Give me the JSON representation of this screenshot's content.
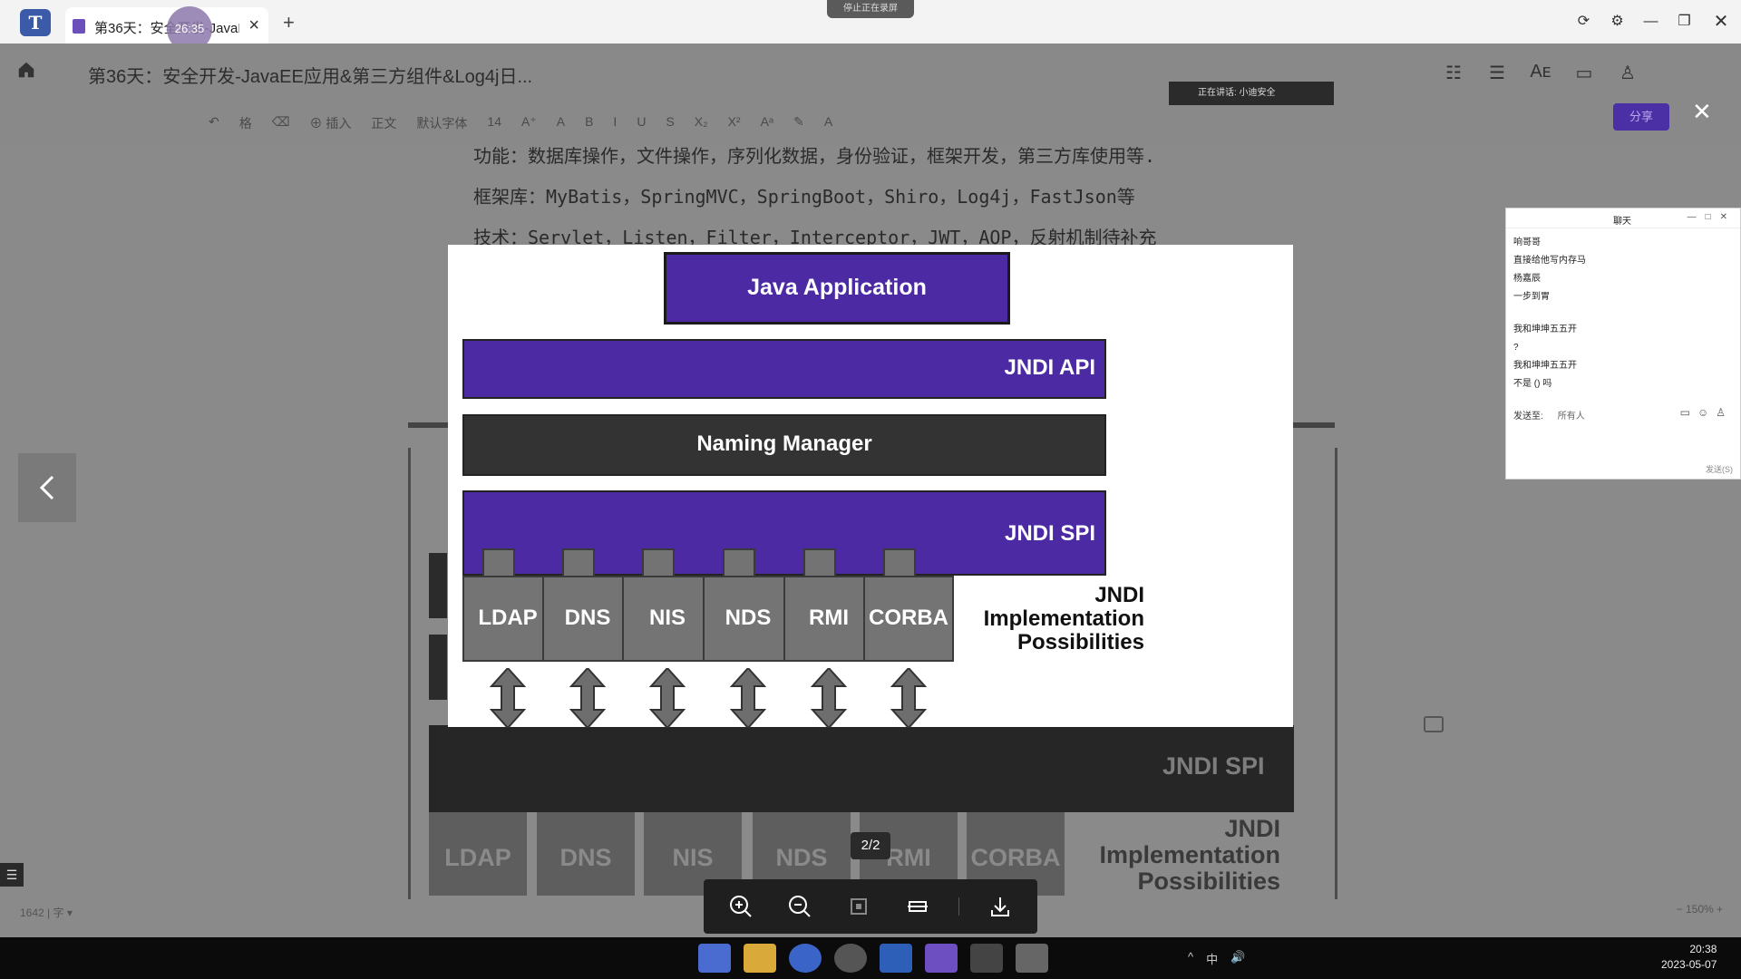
{
  "window": {
    "tab_title": "第36天：安全开发-JavaEE应用...",
    "timer": "26:35",
    "notice": "停止正在录屏",
    "ctrl_icons": [
      "refresh-icon",
      "settings-icon",
      "minimize-icon",
      "restore-icon",
      "close-icon"
    ]
  },
  "header": {
    "doc_title": "第36天：安全开发-JavaEE应用&第三方组件&Log4j日...",
    "mic_text": "正在讲话: 小迪安全",
    "share_label": "分享"
  },
  "toolbar": {
    "items": [
      "↶",
      "格",
      "⌫",
      "⊕ 插入",
      "正文",
      "默认字体",
      "14",
      "A⁺",
      "A",
      "B",
      "I",
      "U",
      "S",
      "X₂",
      "X²",
      "Aᵃ",
      "✎",
      "A"
    ]
  },
  "document": {
    "line1": "功能：数据库操作，文件操作，序列化数据，身份验证，框架开发，第三方库使用等.",
    "line2": "框架库：MyBatis，SpringMVC，SpringBoot，Shiro，Log4j，FastJson等",
    "line3": "技术：Servlet，Listen，Filter，Interceptor，JWT，AOP，反射机制待补充"
  },
  "diagram": {
    "app": "Java Application",
    "api": "JNDI API",
    "manager": "Naming Manager",
    "spi": "JNDI SPI",
    "providers": [
      "LDAP",
      "DNS",
      "NIS",
      "NDS",
      "RMI",
      "CORBA"
    ],
    "impl_label": [
      "JNDI",
      "Implementation",
      "Possibilities"
    ],
    "colors": {
      "layer": "#4b2aa3",
      "manager": "#333333",
      "provider": "#747474"
    }
  },
  "background_slide": {
    "spi": "JNDI SPI",
    "providers": [
      "LDAP",
      "DNS",
      "NIS",
      "NDS",
      "RMI",
      "CORBA"
    ],
    "impl_label": [
      "JNDI",
      "Implementation",
      "Possibilities"
    ]
  },
  "viewer": {
    "page": "2/2",
    "tools": [
      "zoom-in-icon",
      "zoom-out-icon",
      "fit-icon",
      "rotate-icon",
      "download-icon"
    ]
  },
  "chat": {
    "title": "聊天",
    "messages": [
      "响哥哥",
      "直接给他写内存马",
      "杨嘉辰",
      "一步到胃",
      "",
      "我和坤坤五五开",
      "?",
      "我和坤坤五五开",
      "不是 () 吗"
    ],
    "send_to_label": "发送至:",
    "send_to_value": "所有人",
    "footer": "发送(S)"
  },
  "statusbar": {
    "left": "1642 | 字 ▾",
    "right": "− 150% +"
  },
  "taskbar": {
    "apps": [
      "windows-icon",
      "explorer-icon",
      "edge-icon",
      "obs-icon",
      "tencent-docs-icon",
      "photos-icon",
      "terminal-icon",
      "app-icon"
    ],
    "tray": [
      "^",
      "中",
      "🔊"
    ],
    "time": "20:38",
    "date": "2023-05-07"
  }
}
